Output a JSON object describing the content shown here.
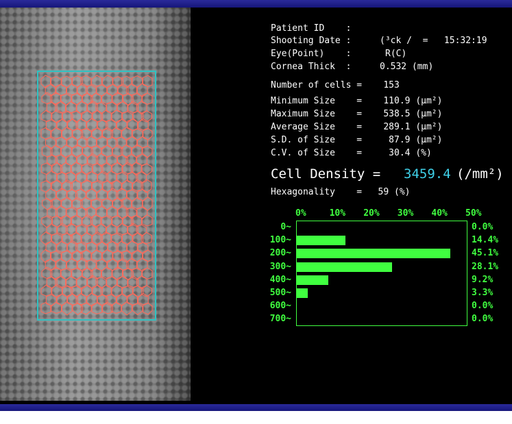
{
  "patient": {
    "id_label": "Patient ID    :",
    "date_label": "Shooting Date :",
    "date_value": "(³ck /  =   15:32:19",
    "eye_label": "Eye(Point)    :",
    "eye_value": "R(C)",
    "cornea_label": "Cornea Thick  :",
    "cornea_value": "0.532 (mm)"
  },
  "stats": {
    "num_cells": "Number of cells =    153",
    "min_size": "Minimum Size    =    110.9 (μm²)",
    "max_size": "Maximum Size    =    538.5 (μm²)",
    "avg_size": "Average Size    =    289.1 (μm²)",
    "sd_size": "S.D. of Size    =     87.9 (μm²)",
    "cv_size": "C.V. of Size    =     30.4 (%)",
    "density_label": "Cell Density = ",
    "density_value": "3459.4",
    "density_unit": "(/mm²)",
    "hex": "Hexagonality    =   59 (%)"
  },
  "colors": {
    "accent_green": "#40ff40",
    "cell_outline": "#ff6a5a",
    "roi_box": "#2fc2c2",
    "density_value": "#3fd0e8"
  },
  "chart_data": {
    "type": "bar",
    "categories": [
      "0",
      "100",
      "200",
      "300",
      "400",
      "500",
      "600",
      "700"
    ],
    "values": [
      0.0,
      14.4,
      45.1,
      28.1,
      9.2,
      3.3,
      0.0,
      0.0
    ],
    "value_labels": [
      "0.0%",
      "14.4%",
      "45.1%",
      "28.1%",
      "9.2%",
      "3.3%",
      "0.0%",
      "0.0%"
    ],
    "x_ticks": [
      "0%",
      "10%",
      "20%",
      "30%",
      "40%",
      "50%"
    ],
    "xlim": [
      0,
      50
    ],
    "orientation": "horizontal"
  }
}
